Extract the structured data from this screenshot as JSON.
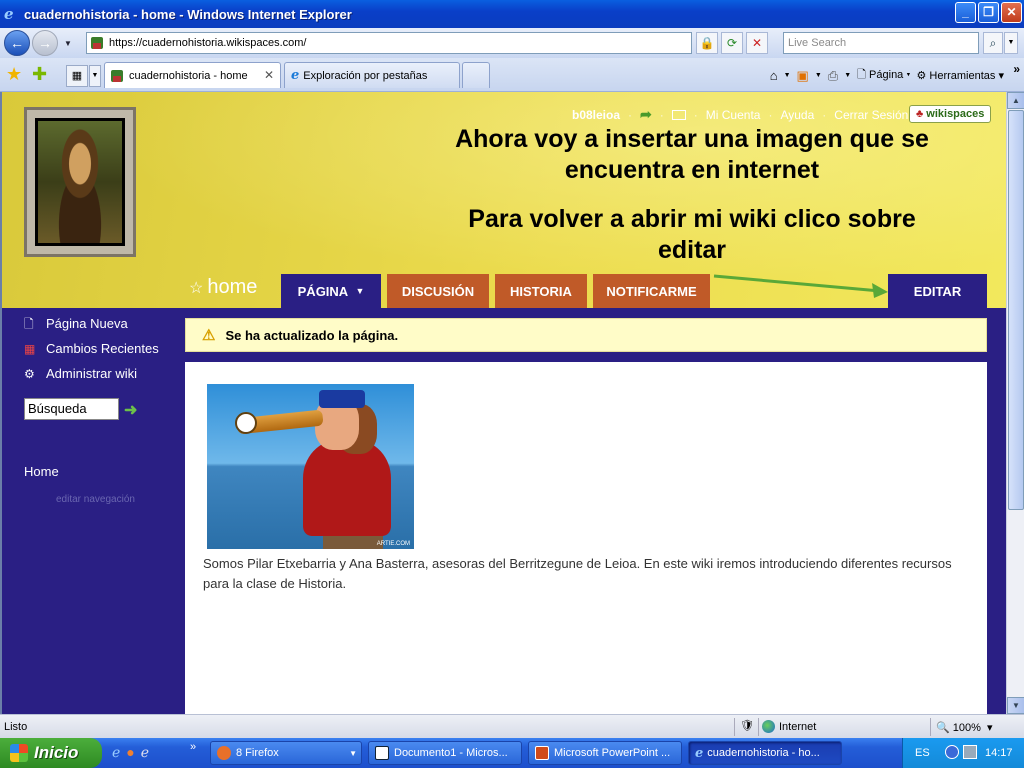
{
  "window": {
    "title": "cuadernohistoria - home - Windows Internet Explorer"
  },
  "address": {
    "url": "https://cuadernohistoria.wikispaces.com/",
    "search_placeholder": "Live Search"
  },
  "tabs": [
    {
      "label": "cuadernohistoria - home",
      "active": true
    },
    {
      "label": "Exploración por pestañas",
      "active": false
    }
  ],
  "toolbar": {
    "pagina": "Página",
    "herramientas": "Herramientas"
  },
  "site": {
    "username": "b08leioa",
    "links": [
      "Mi Cuenta",
      "Ayuda",
      "Cerrar Sesión"
    ],
    "badge": "wikispaces",
    "annotation_1": "Ahora voy a insertar una imagen que se encuentra en internet",
    "annotation_2": "Para volver a abrir mi wiki clico sobre editar",
    "page_name": "home",
    "nav_tabs": [
      "PÁGINA",
      "DISCUSIÓN",
      "HISTORIA",
      "NOTIFICARME"
    ],
    "edit": "EDITAR"
  },
  "sidebar": {
    "items": [
      "Página Nueva",
      "Cambios Recientes",
      "Administrar wiki"
    ],
    "search_value": "Búsqueda",
    "home_link": "Home",
    "edit_nav": "editar navegación"
  },
  "notice": "Se ha actualizado la página.",
  "content": {
    "image_credit": "ARTIE.COM",
    "text": "Somos Pilar Etxebarria y Ana Basterra, asesoras del Berritzegune de Leioa. En este wiki iremos introduciendo diferentes recursos para la clase de Historia."
  },
  "status": {
    "text": "Listo",
    "zone": "Internet",
    "zoom": "100%"
  },
  "taskbar": {
    "start": "Inicio",
    "tasks": [
      "8 Firefox",
      "Documento1 - Micros...",
      "Microsoft PowerPoint ...",
      "cuadernohistoria - ho..."
    ],
    "lang": "ES",
    "clock": "14:17"
  }
}
